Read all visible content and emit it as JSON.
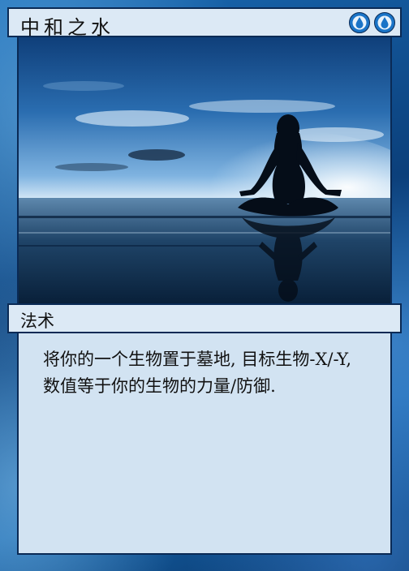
{
  "card": {
    "name": "中和之水",
    "mana_cost": [
      "blue-mana-icon",
      "blue-mana-icon"
    ],
    "type_line": "法术",
    "rules_text": "将你的一个生物置于墓地, 目标生物-X/-Y, 数值等于你的生物的力量/防御."
  },
  "colors": {
    "frame": "#1461a8",
    "bar_fill": "#dce9f5",
    "text_box_fill": "#d2e3f2",
    "border": "#0a2a55",
    "mana": "#1a74c7"
  }
}
